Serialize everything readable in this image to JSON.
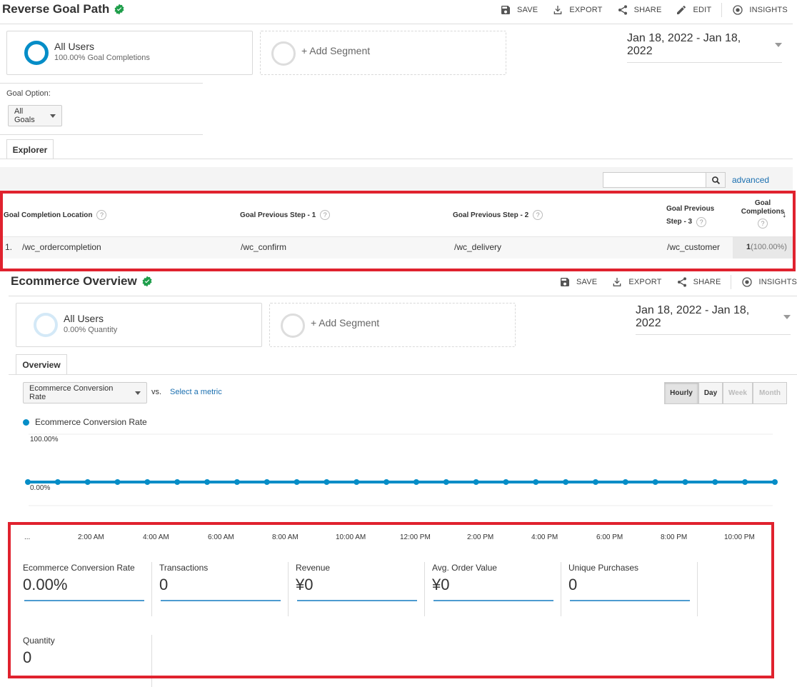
{
  "goal_report": {
    "title": "Reverse Goal Path",
    "toolbar": {
      "save": "SAVE",
      "export": "EXPORT",
      "share": "SHARE",
      "edit": "EDIT",
      "insights": "INSIGHTS"
    },
    "segment": {
      "name": "All Users",
      "sub": "100.00% Goal Completions"
    },
    "add_segment": "+ Add Segment",
    "date_range": "Jan 18, 2022 - Jan 18, 2022",
    "goal_option_label": "Goal Option:",
    "goal_option_value": "All Goals",
    "tab": "Explorer",
    "search_placeholder": "",
    "advanced": "advanced",
    "table": {
      "headers": {
        "col1": "Goal Completion Location",
        "col2": "Goal Previous Step - 1",
        "col3": "Goal Previous Step - 2",
        "col4a": "Goal Previous",
        "col4b": "Step - 3",
        "col5a": "Goal",
        "col5b": "Completions"
      },
      "rows": [
        {
          "index": "1.",
          "location": "/wc_ordercompletion",
          "step1": "/wc_confirm",
          "step2": "/wc_delivery",
          "step3": "/wc_customer",
          "completions": "1",
          "pct": "(100.00%)"
        }
      ]
    }
  },
  "ecom_report": {
    "title": "Ecommerce Overview",
    "toolbar": {
      "save": "SAVE",
      "export": "EXPORT",
      "share": "SHARE",
      "insights": "INSIGHTS"
    },
    "segment": {
      "name": "All Users",
      "sub": "0.00% Quantity"
    },
    "add_segment": "+ Add Segment",
    "date_range": "Jan 18, 2022 - Jan 18, 2022",
    "tab": "Overview",
    "metric_select": "Ecommerce Conversion Rate",
    "vs": "vs.",
    "select_metric": "Select a metric",
    "granularity": {
      "hourly": "Hourly",
      "day": "Day",
      "week": "Week",
      "month": "Month"
    },
    "legend": "Ecommerce Conversion Rate",
    "metrics": [
      {
        "name": "Ecommerce Conversion Rate",
        "value": "0.00%"
      },
      {
        "name": "Transactions",
        "value": "0"
      },
      {
        "name": "Revenue",
        "value": "¥0"
      },
      {
        "name": "Avg. Order Value",
        "value": "¥0"
      },
      {
        "name": "Unique Purchases",
        "value": "0"
      },
      {
        "name": "Quantity",
        "value": "0"
      }
    ]
  },
  "chart_data": {
    "type": "line",
    "series": [
      {
        "name": "Ecommerce Conversion Rate",
        "values": [
          0,
          0,
          0,
          0,
          0,
          0,
          0,
          0,
          0,
          0,
          0,
          0,
          0,
          0,
          0,
          0,
          0,
          0,
          0,
          0,
          0,
          0,
          0,
          0,
          0,
          0
        ]
      }
    ],
    "y_tick_top": "100.00%",
    "y_tick_bottom": "0.00%",
    "x_ticks": [
      "...",
      "2:00 AM",
      "4:00 AM",
      "6:00 AM",
      "8:00 AM",
      "10:00 AM",
      "12:00 PM",
      "2:00 PM",
      "4:00 PM",
      "6:00 PM",
      "8:00 PM",
      "10:00 PM"
    ],
    "ylim": [
      0,
      1
    ],
    "color": "#058dc7"
  },
  "colors": {
    "accent": "#058dc7",
    "highlight": "#e0222e",
    "verified": "#1e9e4a"
  }
}
